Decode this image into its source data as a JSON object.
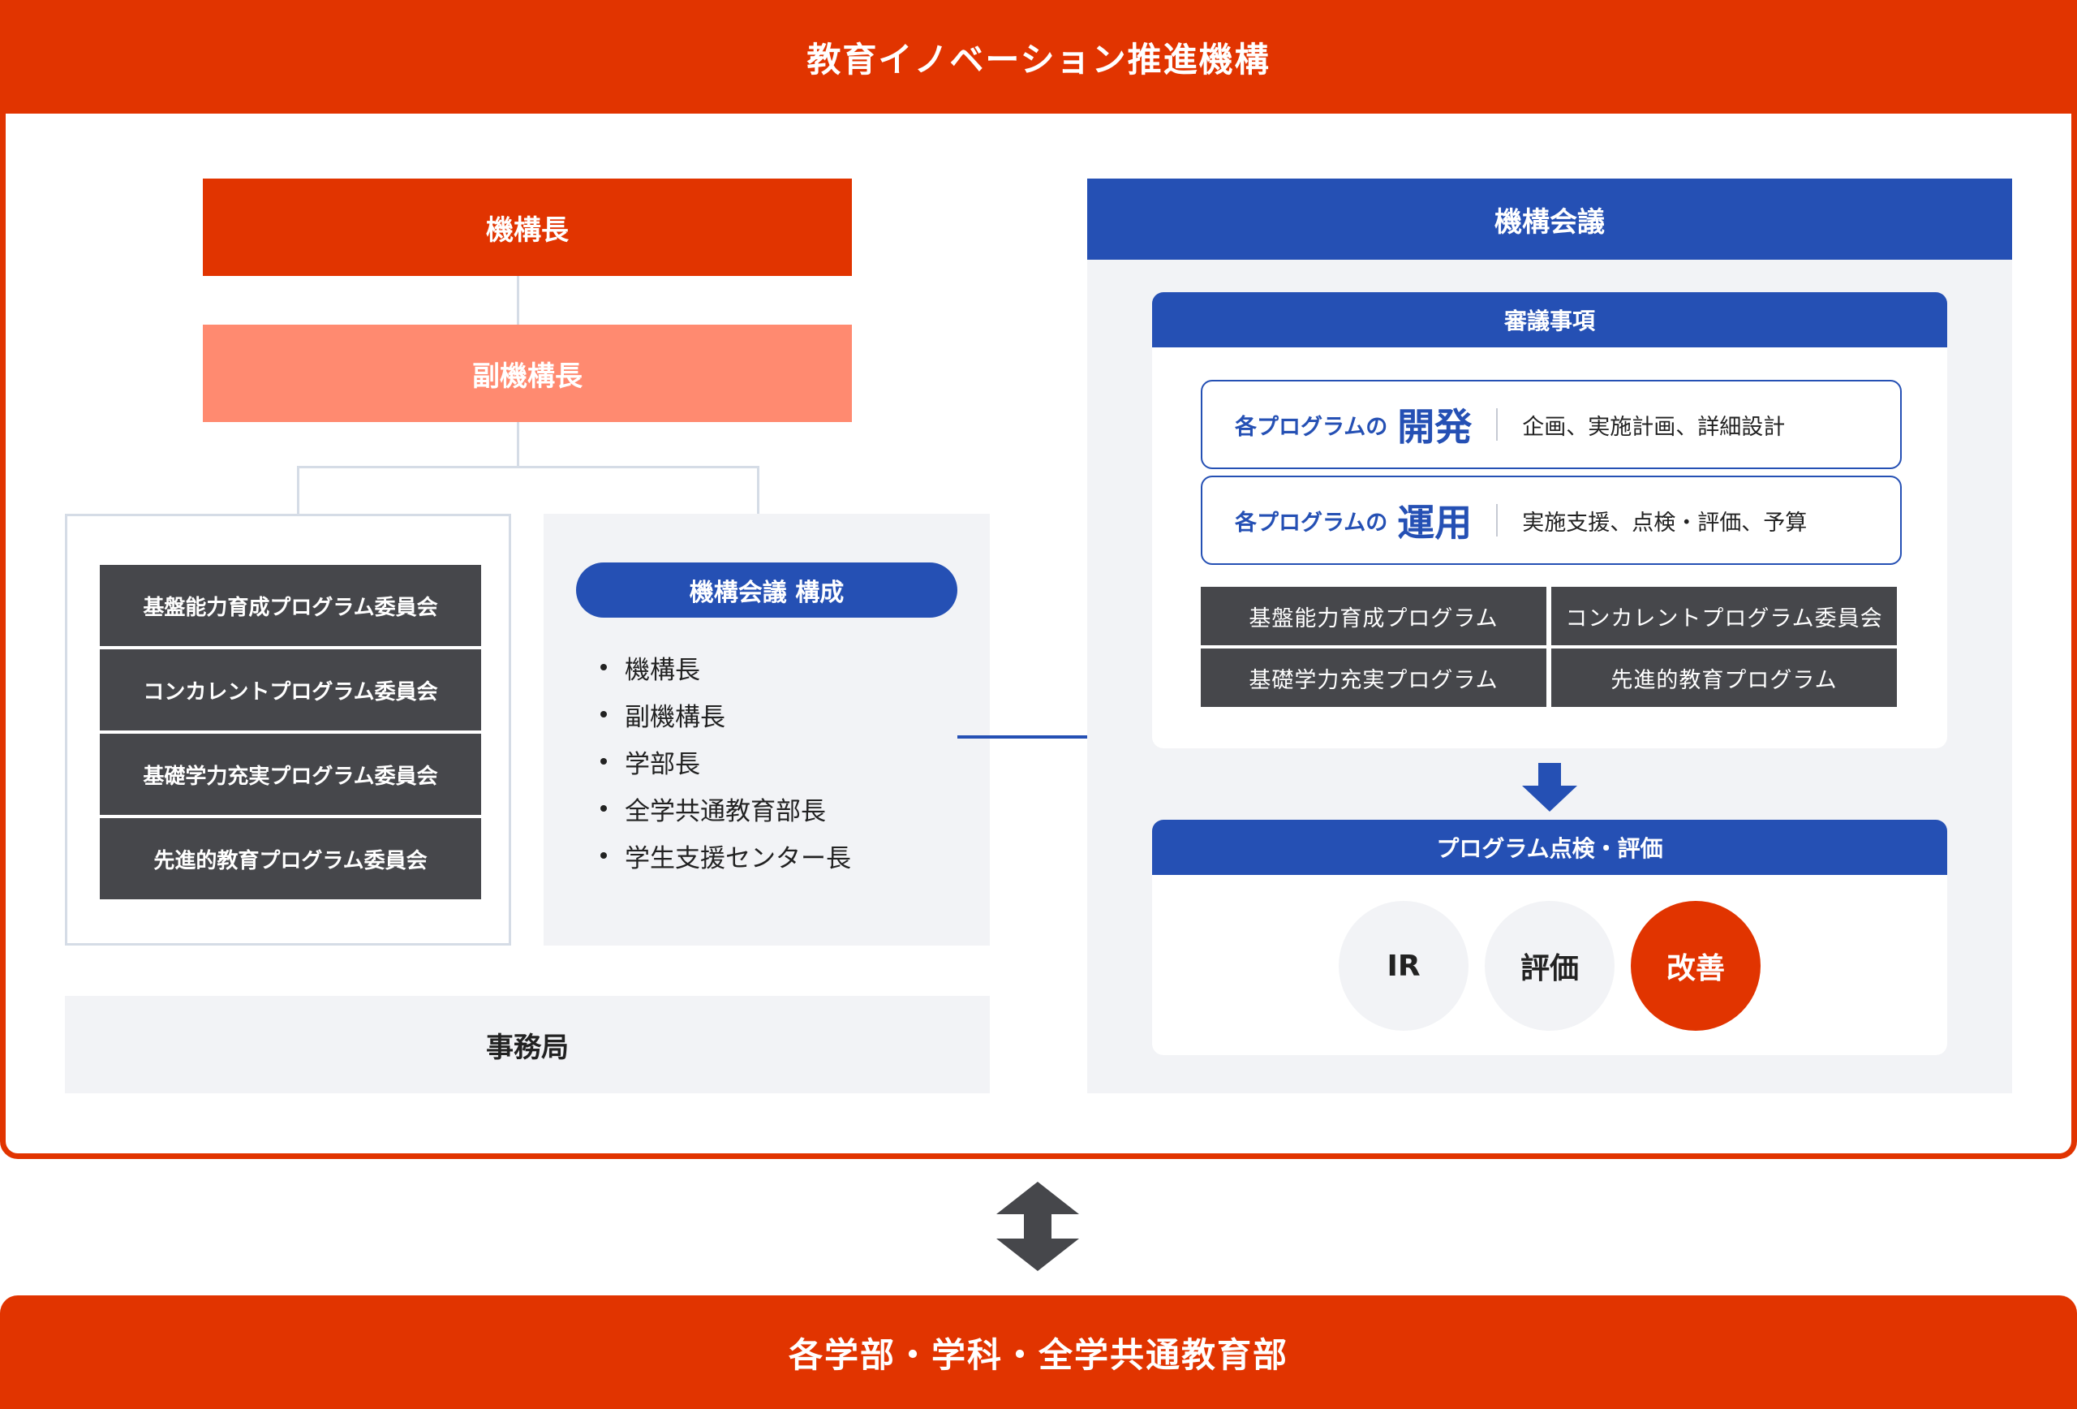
{
  "organization": {
    "title": "教育イノベーション推進機構"
  },
  "left": {
    "director": "機構長",
    "vice_director": "副機構長",
    "committees": [
      "基盤能力育成プログラム委員会",
      "コンカレントプログラム委員会",
      "基礎学力充実プログラム委員会",
      "先進的教育プログラム委員会"
    ],
    "composition": {
      "title": "機構会議 構成",
      "members": [
        "機構長",
        "副機構長",
        "学部長",
        "全学共通教育部長",
        "学生支援センター長"
      ]
    },
    "secretariat": "事務局"
  },
  "council": {
    "title": "機構会議",
    "deliberation": {
      "title": "審議事項",
      "rows": [
        {
          "prefix": "各プログラムの",
          "keyword": "開発",
          "detail": "企画、実施計画、詳細設計"
        },
        {
          "prefix": "各プログラムの",
          "keyword": "運用",
          "detail": "実施支援、点検・評価、予算"
        }
      ],
      "programs": [
        "基盤能力育成プログラム",
        "コンカレントプログラム委員会",
        "基礎学力充実プログラム",
        "先進的教育プログラム"
      ]
    },
    "evaluation": {
      "title": "プログラム点検・評価",
      "items": [
        "IR",
        "評価",
        "改善"
      ]
    }
  },
  "bottom": {
    "title": "各学部・学科・全学共通教育部"
  },
  "colors": {
    "accent_red": "#e13400",
    "accent_blue": "#2550b4",
    "light_red": "#ff8a70",
    "dark_gray": "#46474b"
  }
}
